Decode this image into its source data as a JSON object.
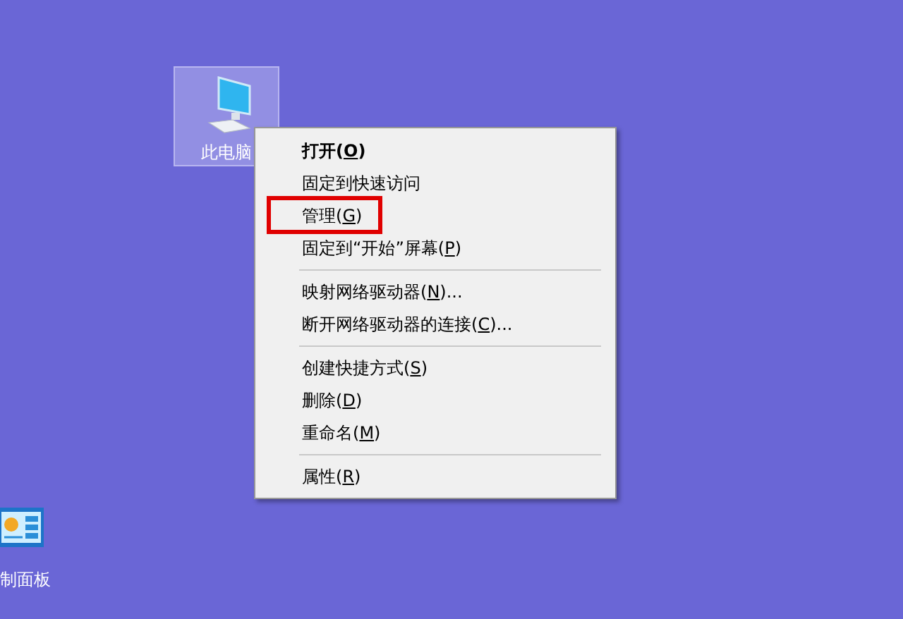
{
  "desktop_icons": [
    {
      "kind": "computer",
      "label": "此电脑",
      "selected": true
    },
    {
      "kind": "control_panel",
      "label": "制面板",
      "selected": false
    }
  ],
  "context_menu": {
    "groups": [
      [
        {
          "before": "打开(",
          "key": "O",
          "after": ")",
          "default": true,
          "highlighted": false
        },
        {
          "before": "固定到快速访问",
          "default": false,
          "highlighted": false
        },
        {
          "before": "管理(",
          "key": "G",
          "after": ")",
          "default": false,
          "highlighted": true
        },
        {
          "before": "固定到“开始”屏幕(",
          "key": "P",
          "after": ")",
          "default": false,
          "highlighted": false
        }
      ],
      [
        {
          "before": "映射网络驱动器(",
          "key": "N",
          "after": ")...",
          "default": false,
          "highlighted": false
        },
        {
          "before": "断开网络驱动器的连接(",
          "key": "C",
          "after": ")...",
          "default": false,
          "highlighted": false
        }
      ],
      [
        {
          "before": "创建快捷方式(",
          "key": "S",
          "after": ")",
          "default": false,
          "highlighted": false
        },
        {
          "before": "删除(",
          "key": "D",
          "after": ")",
          "default": false,
          "highlighted": false
        },
        {
          "before": "重命名(",
          "key": "M",
          "after": ")",
          "default": false,
          "highlighted": false
        }
      ],
      [
        {
          "before": "属性(",
          "key": "R",
          "after": ")",
          "default": false,
          "highlighted": false
        }
      ]
    ]
  }
}
